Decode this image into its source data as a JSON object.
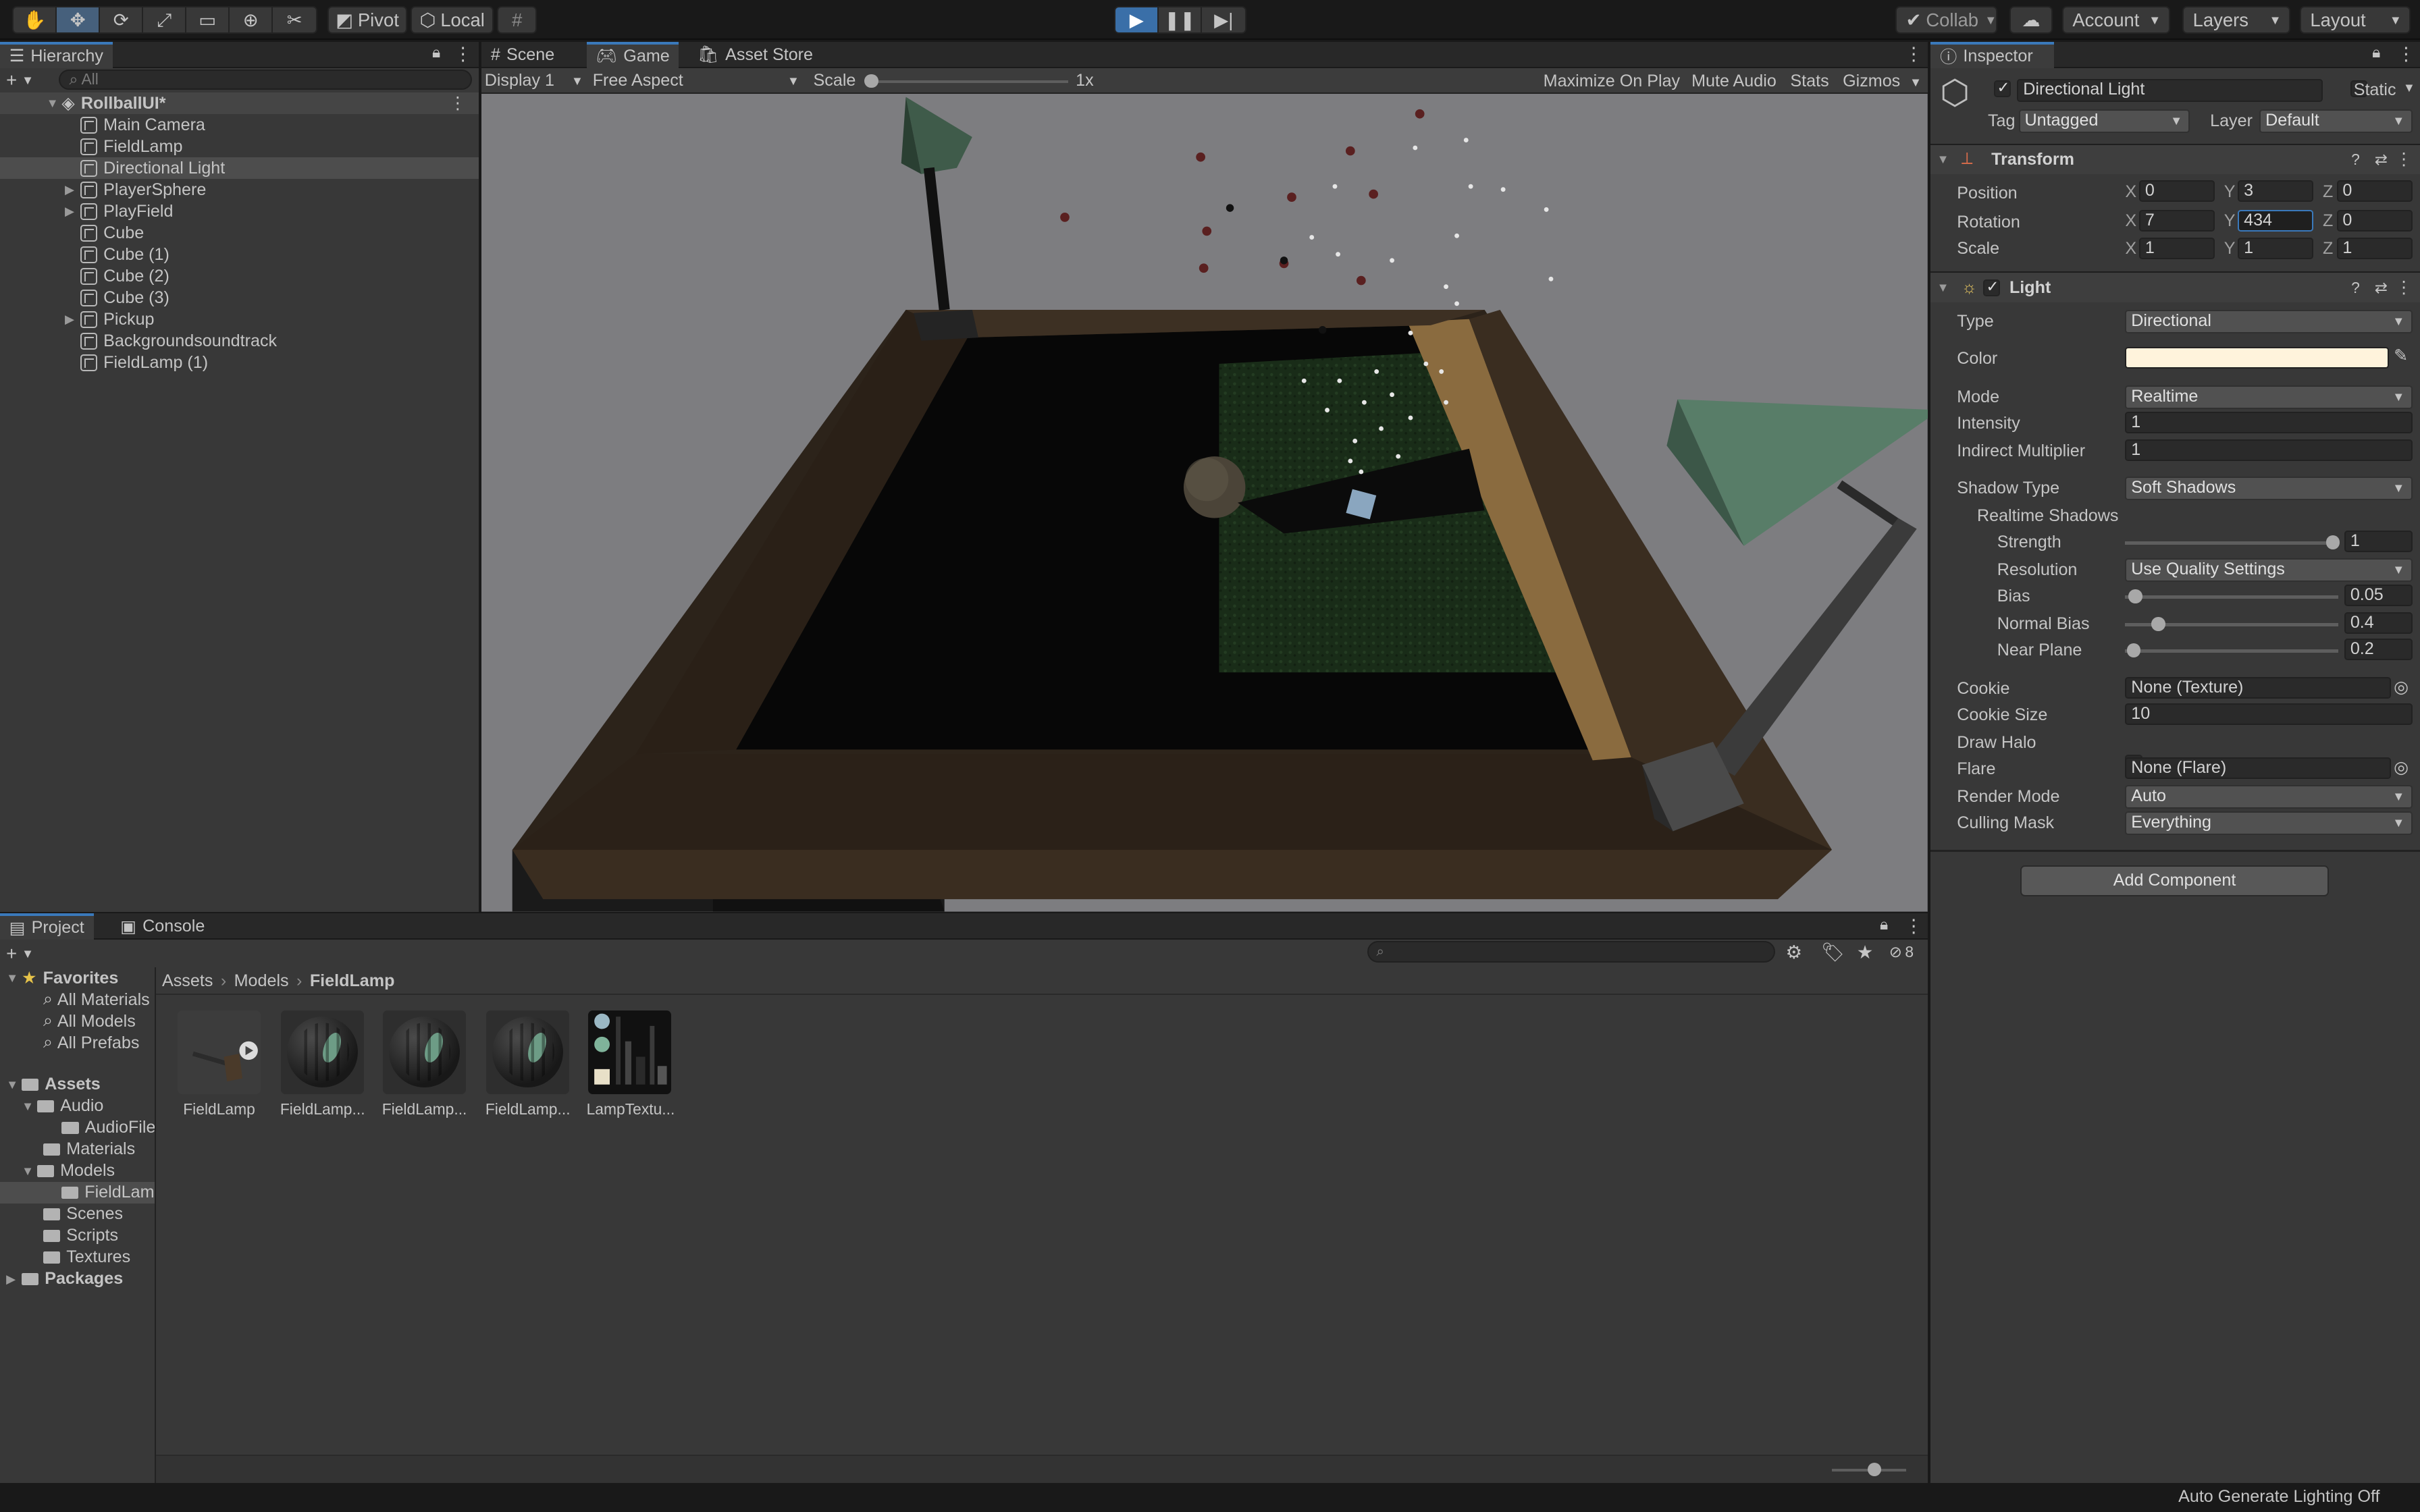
{
  "toolbar": {
    "pivot": "Pivot",
    "local": "Local",
    "collab": "Collab",
    "account": "Account",
    "layers": "Layers",
    "layout": "Layout"
  },
  "hierarchy": {
    "tab": "Hierarchy",
    "search_placeholder": "All",
    "scene": "RollballUI*",
    "items": [
      "Main Camera",
      "FieldLamp",
      "Directional Light",
      "PlayerSphere",
      "PlayField",
      "Cube",
      "Cube (1)",
      "Cube (2)",
      "Cube (3)",
      "Pickup",
      "Backgroundsoundtrack",
      "FieldLamp (1)"
    ]
  },
  "viewtabs": {
    "scene": "Scene",
    "game": "Game",
    "store": "Asset Store"
  },
  "gamebar": {
    "display": "Display 1",
    "aspect": "Free Aspect",
    "scale_label": "Scale",
    "scale_value": "1x",
    "maximize": "Maximize On Play",
    "mute": "Mute Audio",
    "stats": "Stats",
    "gizmos": "Gizmos"
  },
  "inspector": {
    "tab": "Inspector",
    "object_name": "Directional Light",
    "static": "Static",
    "tag_label": "Tag",
    "tag": "Untagged",
    "layer_label": "Layer",
    "layer": "Default",
    "transform": {
      "title": "Transform",
      "position_label": "Position",
      "rotation_label": "Rotation",
      "scale_label": "Scale",
      "position": {
        "x": "0",
        "y": "3",
        "z": "0"
      },
      "rotation": {
        "x": "7",
        "y": "434",
        "z": "0"
      },
      "scale": {
        "x": "1",
        "y": "1",
        "z": "1"
      }
    },
    "light": {
      "title": "Light",
      "type_label": "Type",
      "type": "Directional",
      "color_label": "Color",
      "color": "#fff3dc",
      "mode_label": "Mode",
      "mode": "Realtime",
      "intensity_label": "Intensity",
      "intensity": "1",
      "indirect_label": "Indirect Multiplier",
      "indirect": "1",
      "shadow_type_label": "Shadow Type",
      "shadow_type": "Soft Shadows",
      "realtime_shadows": "Realtime Shadows",
      "strength_label": "Strength",
      "strength": "1",
      "resolution_label": "Resolution",
      "resolution": "Use Quality Settings",
      "bias_label": "Bias",
      "bias": "0.05",
      "normal_bias_label": "Normal Bias",
      "normal_bias": "0.4",
      "near_plane_label": "Near Plane",
      "near_plane": "0.2",
      "cookie_label": "Cookie",
      "cookie": "None (Texture)",
      "cookie_size_label": "Cookie Size",
      "cookie_size": "10",
      "draw_halo_label": "Draw Halo",
      "flare_label": "Flare",
      "flare": "None (Flare)",
      "render_mode_label": "Render Mode",
      "render_mode": "Auto",
      "culling_label": "Culling Mask",
      "culling": "Everything"
    },
    "add_component": "Add Component"
  },
  "project": {
    "tab": "Project",
    "console_tab": "Console",
    "hidden_count": "8",
    "favorites": "Favorites",
    "fav_items": [
      "All Materials",
      "All Models",
      "All Prefabs"
    ],
    "assets": "Assets",
    "audio": "Audio",
    "audiofile": "AudioFile",
    "materials": "Materials",
    "models": "Models",
    "fieldlamp": "FieldLam",
    "scenes": "Scenes",
    "scripts": "Scripts",
    "textures": "Textures",
    "packages": "Packages",
    "breadcrumb": [
      "Assets",
      "Models",
      "FieldLamp"
    ],
    "grid": [
      "FieldLamp",
      "FieldLamp...",
      "FieldLamp...",
      "FieldLamp...",
      "LampTextu..."
    ]
  },
  "status": {
    "text": "Auto Generate Lighting Off"
  }
}
